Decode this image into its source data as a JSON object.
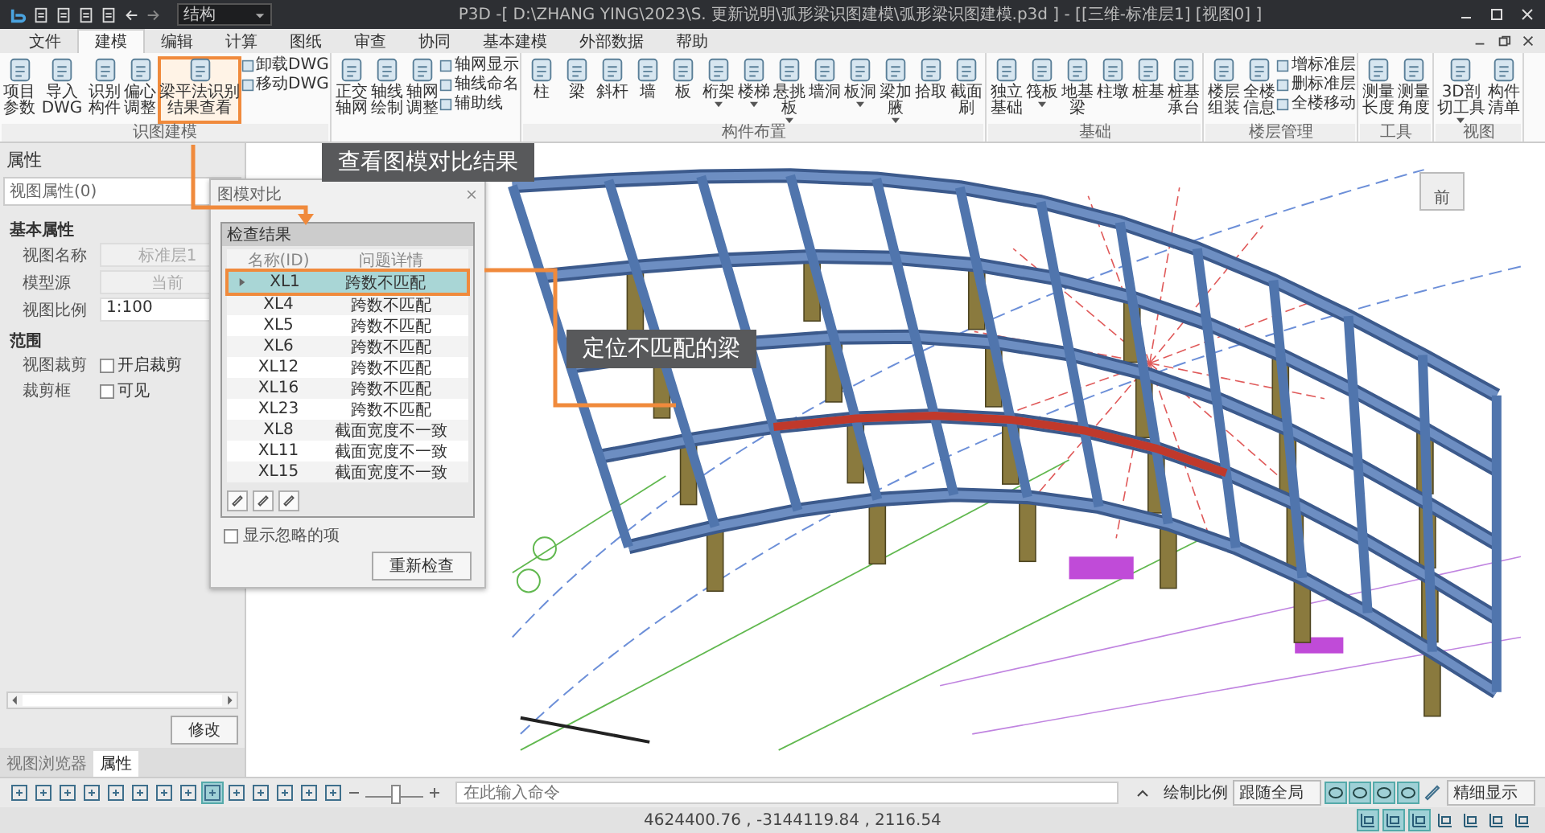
{
  "window": {
    "title": "P3D -[ D:\\ZHANG YING\\2023\\S. 更新说明\\弧形梁识图建模\\弧形梁识图建模.p3d ] - [[三维-标准层1] [视图0] ]",
    "discipline": "结构"
  },
  "menu_tabs": [
    {
      "label": "文件",
      "selected": false
    },
    {
      "label": "建模",
      "selected": true
    },
    {
      "label": "编辑",
      "selected": false
    },
    {
      "label": "计算",
      "selected": false
    },
    {
      "label": "图纸",
      "selected": false
    },
    {
      "label": "审查",
      "selected": false
    },
    {
      "label": "协同",
      "selected": false
    },
    {
      "label": "基本建模",
      "selected": false
    },
    {
      "label": "外部数据",
      "selected": false
    },
    {
      "label": "帮助",
      "selected": false
    }
  ],
  "ribbon": {
    "groups": [
      {
        "label": "识图建模",
        "items": [
          {
            "kind": "large",
            "label": "项目参数",
            "dropdown": false,
            "highlighted": false
          },
          {
            "kind": "large",
            "label": "导入DWG",
            "dropdown": false,
            "highlighted": false
          },
          {
            "kind": "large",
            "label": "识别构件",
            "dropdown": false,
            "highlighted": false
          },
          {
            "kind": "large",
            "label": "偏心调整",
            "dropdown": false,
            "highlighted": false
          },
          {
            "kind": "large",
            "label": "梁平法识别结果查看",
            "dropdown": false,
            "highlighted": true
          },
          {
            "kind": "stack",
            "items": [
              "卸载DWG",
              "移动DWG"
            ]
          }
        ]
      },
      {
        "items": [
          {
            "kind": "large",
            "label": "正交轴网",
            "dropdown": false,
            "highlighted": false
          },
          {
            "kind": "large",
            "label": "轴线绘制",
            "dropdown": false,
            "highlighted": false
          },
          {
            "kind": "large",
            "label": "轴网调整",
            "dropdown": false,
            "highlighted": false
          },
          {
            "kind": "stack",
            "items": [
              "轴网显示",
              "轴线命名",
              "辅助线"
            ]
          }
        ]
      },
      {
        "label": "构件布置",
        "items": [
          {
            "kind": "large",
            "label": "柱",
            "dropdown": false,
            "highlighted": false
          },
          {
            "kind": "large",
            "label": "梁",
            "dropdown": false,
            "highlighted": false
          },
          {
            "kind": "large",
            "label": "斜杆",
            "dropdown": false,
            "highlighted": false
          },
          {
            "kind": "large",
            "label": "墙",
            "dropdown": false,
            "highlighted": false
          },
          {
            "kind": "large",
            "label": "板",
            "dropdown": false,
            "highlighted": false
          },
          {
            "kind": "large",
            "label": "桁架",
            "dropdown": true,
            "highlighted": false
          },
          {
            "kind": "large",
            "label": "楼梯",
            "dropdown": true,
            "highlighted": false
          },
          {
            "kind": "large",
            "label": "悬挑板",
            "dropdown": true,
            "highlighted": false
          },
          {
            "kind": "large",
            "label": "墙洞",
            "dropdown": false,
            "highlighted": false
          },
          {
            "kind": "large",
            "label": "板洞",
            "dropdown": true,
            "highlighted": false
          },
          {
            "kind": "large",
            "label": "梁加腋",
            "dropdown": true,
            "highlighted": false
          },
          {
            "kind": "large",
            "label": "拾取",
            "dropdown": false,
            "highlighted": false
          },
          {
            "kind": "large",
            "label": "截面刷",
            "dropdown": false,
            "highlighted": false
          }
        ]
      },
      {
        "label": "基础",
        "items": [
          {
            "kind": "large",
            "label": "独立基础",
            "dropdown": false,
            "highlighted": false
          },
          {
            "kind": "large",
            "label": "筏板",
            "dropdown": true,
            "highlighted": false
          },
          {
            "kind": "large",
            "label": "地基梁",
            "dropdown": false,
            "highlighted": false
          },
          {
            "kind": "large",
            "label": "柱墩",
            "dropdown": false,
            "highlighted": false
          },
          {
            "kind": "large",
            "label": "桩基",
            "dropdown": false,
            "highlighted": false
          },
          {
            "kind": "large",
            "label": "桩基承台",
            "dropdown": false,
            "highlighted": false
          }
        ]
      },
      {
        "label": "楼层管理",
        "items": [
          {
            "kind": "large",
            "label": "楼层组装",
            "dropdown": false,
            "highlighted": false
          },
          {
            "kind": "large",
            "label": "全楼信息",
            "dropdown": false,
            "highlighted": false
          },
          {
            "kind": "stack",
            "items": [
              "增标准层",
              "删标准层",
              "全楼移动"
            ]
          }
        ]
      },
      {
        "label": "工具",
        "items": [
          {
            "kind": "large",
            "label": "测量长度",
            "dropdown": false,
            "highlighted": false
          },
          {
            "kind": "large",
            "label": "测量角度",
            "dropdown": false,
            "highlighted": false
          }
        ]
      },
      {
        "label": "视图",
        "items": [
          {
            "kind": "large",
            "label": "3D剖切工具",
            "dropdown": true,
            "highlighted": false
          },
          {
            "kind": "large",
            "label": "构件清单",
            "dropdown": false,
            "highlighted": false
          }
        ]
      }
    ]
  },
  "properties": {
    "title": "属性",
    "selector": "视图属性(0)",
    "sections": [
      {
        "title": "基本属性",
        "rows": [
          {
            "kind": "field",
            "label": "视图名称",
            "value": "标准层1",
            "disabled": true
          },
          {
            "kind": "field",
            "label": "模型源",
            "value": "当前",
            "disabled": true
          },
          {
            "kind": "field",
            "label": "视图比例",
            "value": "1:100",
            "disabled": false
          }
        ]
      },
      {
        "title": "范围",
        "rows": [
          {
            "kind": "checkbox",
            "label": "视图裁剪",
            "text": "开启裁剪",
            "checked": false
          },
          {
            "kind": "checkbox",
            "label": "裁剪框",
            "text": "可见",
            "checked": false
          }
        ]
      }
    ],
    "apply_button": "修改",
    "tabs": [
      {
        "label": "视图浏览器",
        "selected": false
      },
      {
        "label": "属性",
        "selected": true
      }
    ]
  },
  "dialog": {
    "title": "图模对比",
    "group": "检查结果",
    "columns": [
      "名称(ID)",
      "问题详情"
    ],
    "rows": [
      {
        "id": "XL1",
        "issue": "跨数不匹配",
        "selected": true
      },
      {
        "id": "XL4",
        "issue": "跨数不匹配",
        "selected": false
      },
      {
        "id": "XL5",
        "issue": "跨数不匹配",
        "selected": false
      },
      {
        "id": "XL6",
        "issue": "跨数不匹配",
        "selected": false
      },
      {
        "id": "XL12",
        "issue": "跨数不匹配",
        "selected": false
      },
      {
        "id": "XL16",
        "issue": "跨数不匹配",
        "selected": false
      },
      {
        "id": "XL23",
        "issue": "跨数不匹配",
        "selected": false
      },
      {
        "id": "XL8",
        "issue": "截面宽度不一致",
        "selected": false
      },
      {
        "id": "XL11",
        "issue": "截面宽度不一致",
        "selected": false
      },
      {
        "id": "XL15",
        "issue": "截面宽度不一致",
        "selected": false
      }
    ],
    "show_ignored": {
      "label": "显示忽略的项",
      "checked": false
    },
    "recheck_button": "重新检查"
  },
  "callouts": [
    "查看图模对比结果",
    "定位不匹配的梁"
  ],
  "view_cube": {
    "face": "前"
  },
  "command_line": {
    "placeholder": "在此输入命令"
  },
  "zoom_slider": {
    "level": 0.5
  },
  "view_bar": {
    "scale_label": "绘制比例",
    "scale_value": "跟随全局",
    "display_mode": "精细显示"
  },
  "status_bar": {
    "coordinates": "4624400.76 , -3144119.84 , 2116.54"
  }
}
